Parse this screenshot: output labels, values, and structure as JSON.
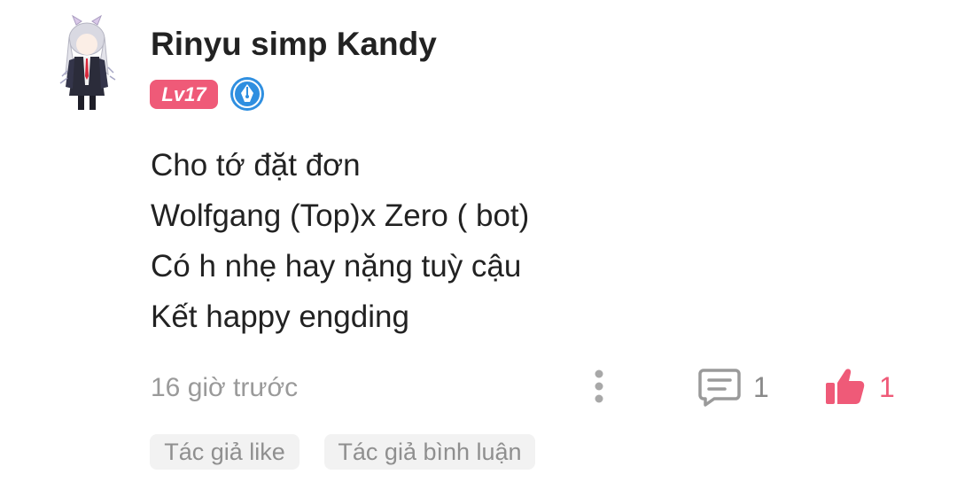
{
  "comment": {
    "author": {
      "name": "Rinyu simp Kandy",
      "level": "Lv17",
      "avatar_icon": "anime-character-avatar",
      "badge_icon": "fountain-pen-badge-icon"
    },
    "lines": [
      "Cho tớ đặt đơn",
      "Wolfgang (Top)x Zero ( bot)",
      "Có h nhẹ hay nặng tuỳ cậu",
      "Kết happy engding"
    ],
    "timestamp": "16 giờ trước",
    "reply_count": "1",
    "like_count": "1",
    "tags": [
      "Tác giả like",
      "Tác giả bình luận"
    ]
  },
  "colors": {
    "accent": "#ef5a78",
    "level_badge": "#ef5a78",
    "pen_badge": "#2f8fe0",
    "muted_text": "#9a9a9a",
    "tag_background": "#f2f2f2"
  }
}
